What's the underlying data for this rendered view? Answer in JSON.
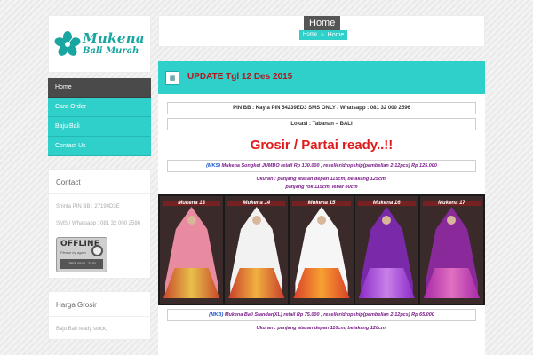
{
  "logo": {
    "line1": "Mukena",
    "line2": "Bali Murah"
  },
  "nav": {
    "items": [
      {
        "label": "Home",
        "active": true
      },
      {
        "label": "Cara Order",
        "active": false
      },
      {
        "label": "Baju Bali",
        "active": false
      },
      {
        "label": "Contact Us",
        "active": false
      }
    ]
  },
  "contact_widget": {
    "title": "Contact",
    "pin": "Shinta PIN BB : 27194D3E",
    "sms": "SMS / Whatsapp : 081 32 000 2596",
    "badge": {
      "title": "OFFLINE",
      "subtitle": "Please try again",
      "hours": "OPEN 08:00 - 21:00"
    }
  },
  "harga_widget": {
    "title": "Harga Grosir",
    "text": "Baju Bali ready stock,"
  },
  "header": {
    "page_title": "Home",
    "breadcrumb_home": "Home",
    "breadcrumb_current": "Home"
  },
  "post": {
    "title": "UPDATE Tgl 12 Des 2015",
    "pin_line": "PIN BB : Kayla PIN 54239ED3    SMS ONLY / Whatsapp : 081 32 000 2596",
    "lokasi": "Lokasi : Tabanan – BALI",
    "headline": "Grosir / Partai ready..!!",
    "mks_code": "(MKS)",
    "mks_text": " Mukena Songket JUMBO retail Rp 130.000 , reseller/dropship(pembelian 2-12pcs) Rp 125.000",
    "mks_size1": "Ukuran : panjang atasan depan 115cm, belakang 125cm.",
    "mks_size2": "panjang rok 115cm, lebar 80cm",
    "gallery": [
      {
        "caption": "Mukena 13",
        "color": "#e88aa0"
      },
      {
        "caption": "Mukena 14",
        "color": "#f2f2f2"
      },
      {
        "caption": "Mukena 15",
        "color": "#f6f6f6"
      },
      {
        "caption": "Mukena 16",
        "color": "#7a2aa8"
      },
      {
        "caption": "Mukena 17",
        "color": "#8a2a9a"
      }
    ],
    "mkb_code": "(MKB)",
    "mkb_text": " Mukena Bali Standar(XL) retail Rp 75.000 , reseller/dropship(pembelian 2-12pcs) Rp 65.000",
    "mkb_size1": "Ukuran : panjang atasan depan 110cm, belakang 120cm."
  },
  "colors": {
    "accent": "#2fd0c9",
    "nav_active": "#4a4a4a",
    "headline_red": "#e11b1b",
    "title_red": "#b3171b"
  }
}
